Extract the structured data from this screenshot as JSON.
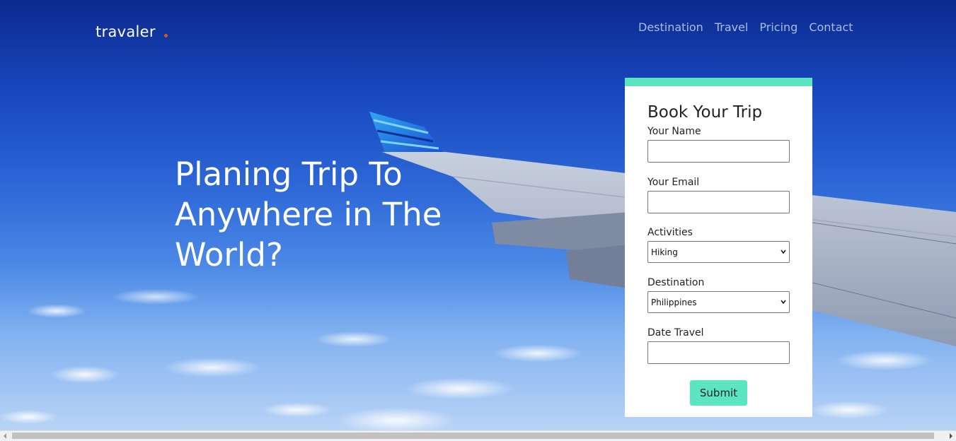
{
  "brand": {
    "name": "travaler",
    "accent_color": "#e0571f"
  },
  "nav": {
    "items": [
      "Destination",
      "Travel",
      "Pricing",
      "Contact"
    ]
  },
  "hero": {
    "headline": "Planing Trip To Anywhere in The World?"
  },
  "booking": {
    "title": "Book Your Trip",
    "accent_color": "#5ce5c3",
    "name_label": "Your Name",
    "name_value": "",
    "email_label": "Your Email",
    "email_value": "",
    "activities_label": "Activities",
    "activities_selected": "Hiking",
    "destination_label": "Destination",
    "destination_selected": "Philippines",
    "date_label": "Date Travel",
    "date_value": "",
    "submit_label": "Submit"
  },
  "icons": {
    "select_arrow": "chevron-down-icon",
    "scroll_left": "scroll-left-arrow-icon",
    "scroll_right": "scroll-right-arrow-icon"
  }
}
